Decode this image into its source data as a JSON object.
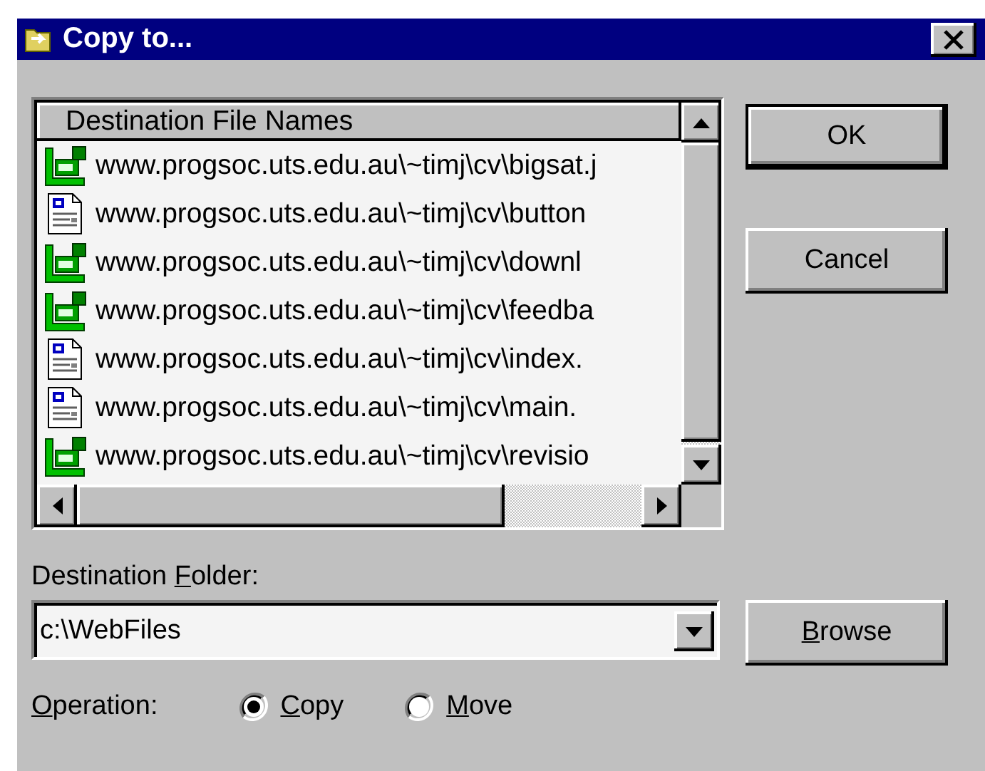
{
  "window": {
    "title": "Copy to..."
  },
  "file_list": {
    "column": "Destination File Names",
    "items": [
      {
        "kind": "image",
        "name": "www.progsoc.uts.edu.au\\~timj\\cv\\bigsat.j"
      },
      {
        "kind": "document",
        "name": "www.progsoc.uts.edu.au\\~timj\\cv\\button"
      },
      {
        "kind": "image",
        "name": "www.progsoc.uts.edu.au\\~timj\\cv\\downl"
      },
      {
        "kind": "image",
        "name": "www.progsoc.uts.edu.au\\~timj\\cv\\feedba"
      },
      {
        "kind": "document",
        "name": "www.progsoc.uts.edu.au\\~timj\\cv\\index."
      },
      {
        "kind": "document",
        "name": "www.progsoc.uts.edu.au\\~timj\\cv\\main."
      },
      {
        "kind": "image",
        "name": "www.progsoc.uts.edu.au\\~timj\\cv\\revisio"
      }
    ]
  },
  "buttons": [
    {
      "label": "OK",
      "default": true
    },
    {
      "label": "Cancel",
      "default": false
    }
  ],
  "destination_folder": {
    "label": {
      "pre": "Destination ",
      "key": "F",
      "rest": "older:"
    },
    "value": "c:\\WebFiles"
  },
  "browse_button": {
    "label": {
      "key": "B",
      "rest": "rowse"
    }
  },
  "operation": {
    "label": {
      "key": "O",
      "rest": "peration:"
    },
    "options": [
      {
        "label": {
          "key": "C",
          "rest": "opy"
        },
        "selected": true
      },
      {
        "label": {
          "key": "M",
          "rest": "ove"
        },
        "selected": false
      }
    ]
  }
}
